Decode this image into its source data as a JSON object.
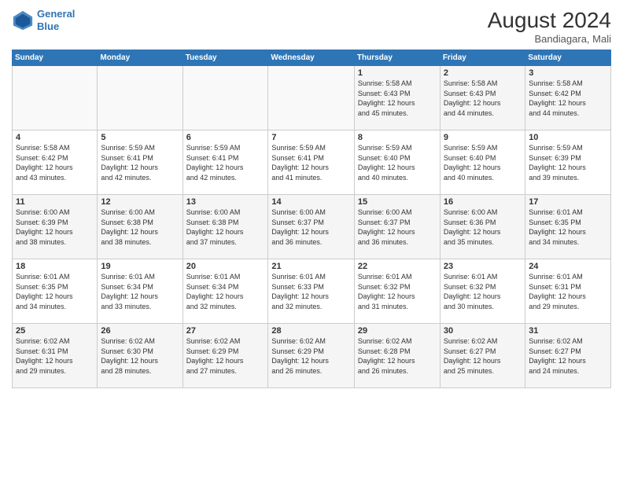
{
  "logo": {
    "line1": "General",
    "line2": "Blue"
  },
  "title": "August 2024",
  "location": "Bandiagara, Mali",
  "days_of_week": [
    "Sunday",
    "Monday",
    "Tuesday",
    "Wednesday",
    "Thursday",
    "Friday",
    "Saturday"
  ],
  "weeks": [
    [
      {
        "day": "",
        "info": ""
      },
      {
        "day": "",
        "info": ""
      },
      {
        "day": "",
        "info": ""
      },
      {
        "day": "",
        "info": ""
      },
      {
        "day": "1",
        "info": "Sunrise: 5:58 AM\nSunset: 6:43 PM\nDaylight: 12 hours\nand 45 minutes."
      },
      {
        "day": "2",
        "info": "Sunrise: 5:58 AM\nSunset: 6:43 PM\nDaylight: 12 hours\nand 44 minutes."
      },
      {
        "day": "3",
        "info": "Sunrise: 5:58 AM\nSunset: 6:42 PM\nDaylight: 12 hours\nand 44 minutes."
      }
    ],
    [
      {
        "day": "4",
        "info": "Sunrise: 5:58 AM\nSunset: 6:42 PM\nDaylight: 12 hours\nand 43 minutes."
      },
      {
        "day": "5",
        "info": "Sunrise: 5:59 AM\nSunset: 6:41 PM\nDaylight: 12 hours\nand 42 minutes."
      },
      {
        "day": "6",
        "info": "Sunrise: 5:59 AM\nSunset: 6:41 PM\nDaylight: 12 hours\nand 42 minutes."
      },
      {
        "day": "7",
        "info": "Sunrise: 5:59 AM\nSunset: 6:41 PM\nDaylight: 12 hours\nand 41 minutes."
      },
      {
        "day": "8",
        "info": "Sunrise: 5:59 AM\nSunset: 6:40 PM\nDaylight: 12 hours\nand 40 minutes."
      },
      {
        "day": "9",
        "info": "Sunrise: 5:59 AM\nSunset: 6:40 PM\nDaylight: 12 hours\nand 40 minutes."
      },
      {
        "day": "10",
        "info": "Sunrise: 5:59 AM\nSunset: 6:39 PM\nDaylight: 12 hours\nand 39 minutes."
      }
    ],
    [
      {
        "day": "11",
        "info": "Sunrise: 6:00 AM\nSunset: 6:39 PM\nDaylight: 12 hours\nand 38 minutes."
      },
      {
        "day": "12",
        "info": "Sunrise: 6:00 AM\nSunset: 6:38 PM\nDaylight: 12 hours\nand 38 minutes."
      },
      {
        "day": "13",
        "info": "Sunrise: 6:00 AM\nSunset: 6:38 PM\nDaylight: 12 hours\nand 37 minutes."
      },
      {
        "day": "14",
        "info": "Sunrise: 6:00 AM\nSunset: 6:37 PM\nDaylight: 12 hours\nand 36 minutes."
      },
      {
        "day": "15",
        "info": "Sunrise: 6:00 AM\nSunset: 6:37 PM\nDaylight: 12 hours\nand 36 minutes."
      },
      {
        "day": "16",
        "info": "Sunrise: 6:00 AM\nSunset: 6:36 PM\nDaylight: 12 hours\nand 35 minutes."
      },
      {
        "day": "17",
        "info": "Sunrise: 6:01 AM\nSunset: 6:35 PM\nDaylight: 12 hours\nand 34 minutes."
      }
    ],
    [
      {
        "day": "18",
        "info": "Sunrise: 6:01 AM\nSunset: 6:35 PM\nDaylight: 12 hours\nand 34 minutes."
      },
      {
        "day": "19",
        "info": "Sunrise: 6:01 AM\nSunset: 6:34 PM\nDaylight: 12 hours\nand 33 minutes."
      },
      {
        "day": "20",
        "info": "Sunrise: 6:01 AM\nSunset: 6:34 PM\nDaylight: 12 hours\nand 32 minutes."
      },
      {
        "day": "21",
        "info": "Sunrise: 6:01 AM\nSunset: 6:33 PM\nDaylight: 12 hours\nand 32 minutes."
      },
      {
        "day": "22",
        "info": "Sunrise: 6:01 AM\nSunset: 6:32 PM\nDaylight: 12 hours\nand 31 minutes."
      },
      {
        "day": "23",
        "info": "Sunrise: 6:01 AM\nSunset: 6:32 PM\nDaylight: 12 hours\nand 30 minutes."
      },
      {
        "day": "24",
        "info": "Sunrise: 6:01 AM\nSunset: 6:31 PM\nDaylight: 12 hours\nand 29 minutes."
      }
    ],
    [
      {
        "day": "25",
        "info": "Sunrise: 6:02 AM\nSunset: 6:31 PM\nDaylight: 12 hours\nand 29 minutes."
      },
      {
        "day": "26",
        "info": "Sunrise: 6:02 AM\nSunset: 6:30 PM\nDaylight: 12 hours\nand 28 minutes."
      },
      {
        "day": "27",
        "info": "Sunrise: 6:02 AM\nSunset: 6:29 PM\nDaylight: 12 hours\nand 27 minutes."
      },
      {
        "day": "28",
        "info": "Sunrise: 6:02 AM\nSunset: 6:29 PM\nDaylight: 12 hours\nand 26 minutes."
      },
      {
        "day": "29",
        "info": "Sunrise: 6:02 AM\nSunset: 6:28 PM\nDaylight: 12 hours\nand 26 minutes."
      },
      {
        "day": "30",
        "info": "Sunrise: 6:02 AM\nSunset: 6:27 PM\nDaylight: 12 hours\nand 25 minutes."
      },
      {
        "day": "31",
        "info": "Sunrise: 6:02 AM\nSunset: 6:27 PM\nDaylight: 12 hours\nand 24 minutes."
      }
    ]
  ]
}
